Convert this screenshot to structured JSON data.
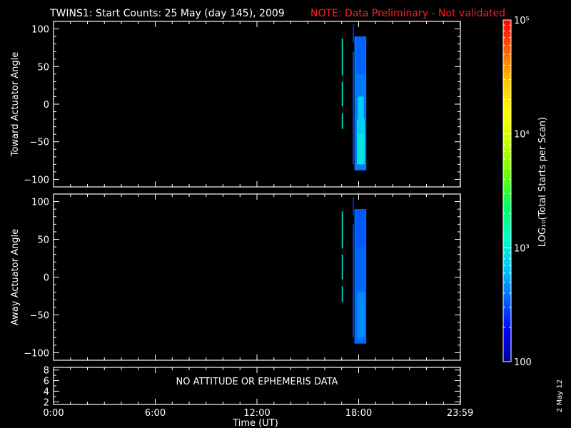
{
  "header": {
    "title": "TWINS1: Start Counts: 25 May (day 145), 2009",
    "note": "NOTE: Data Preliminary - Not validated"
  },
  "date_stamp": "2 May 12",
  "colorbar": {
    "label": "LOG₁₀(Total Starts per Scan)",
    "scale": "log",
    "range": [
      100,
      100000
    ],
    "tick_labels": [
      "100",
      "10³",
      "10⁴",
      "10⁵"
    ],
    "tick_values": [
      100,
      1000,
      10000,
      100000
    ],
    "colormap": [
      "#000096",
      "#0000ff",
      "#0064ff",
      "#00c8ff",
      "#00ffc8",
      "#00ff64",
      "#64ff00",
      "#c8ff00",
      "#ffff00",
      "#ffc800",
      "#ff6400",
      "#ff0000"
    ]
  },
  "chart_data": [
    {
      "type": "heatmap",
      "panel": "toward",
      "title": "",
      "xlabel": "",
      "ylabel": "Toward Actuator Angle",
      "xlim": [
        0,
        24
      ],
      "ylim": [
        -110,
        110
      ],
      "y_ticks": [
        100,
        50,
        0,
        -50,
        -100
      ],
      "y_tick_labels": [
        "100",
        "50",
        "0",
        "−50",
        "−100"
      ],
      "intervals": [
        {
          "t_start": 17.0,
          "t_end": 17.07,
          "angle_min": 38,
          "angle_max": 87,
          "counts": 1100
        },
        {
          "t_start": 17.0,
          "t_end": 17.07,
          "angle_min": -3,
          "angle_max": 30,
          "counts": 1050
        },
        {
          "t_start": 17.0,
          "t_end": 17.07,
          "angle_min": -33,
          "angle_max": -12,
          "counts": 1000
        },
        {
          "t_start": 17.65,
          "t_end": 17.72,
          "angle_min": 82,
          "angle_max": 106,
          "counts": 260
        },
        {
          "t_start": 17.65,
          "t_end": 17.72,
          "angle_min": -80,
          "angle_max": 70,
          "counts": 300
        },
        {
          "t_start": 17.75,
          "t_end": 18.45,
          "angle_min": -88,
          "angle_max": 90,
          "counts": 400
        },
        {
          "t_start": 17.9,
          "t_end": 18.35,
          "angle_min": -80,
          "angle_max": -20,
          "counts": 950
        },
        {
          "t_start": 17.95,
          "t_end": 18.3,
          "angle_min": -40,
          "angle_max": 10,
          "counts": 700
        },
        {
          "t_start": 17.85,
          "t_end": 18.4,
          "angle_min": 40,
          "angle_max": 90,
          "counts": 350
        }
      ]
    },
    {
      "type": "heatmap",
      "panel": "away",
      "title": "",
      "xlabel": "",
      "ylabel": "Away Actuator Angle",
      "xlim": [
        0,
        24
      ],
      "ylim": [
        -110,
        110
      ],
      "y_ticks": [
        100,
        50,
        0,
        -50,
        -100
      ],
      "y_tick_labels": [
        "100",
        "50",
        "0",
        "−50",
        "−100"
      ],
      "intervals": [
        {
          "t_start": 17.0,
          "t_end": 17.07,
          "angle_min": 38,
          "angle_max": 87,
          "counts": 1000
        },
        {
          "t_start": 17.0,
          "t_end": 17.07,
          "angle_min": -3,
          "angle_max": 30,
          "counts": 900
        },
        {
          "t_start": 17.0,
          "t_end": 17.07,
          "angle_min": -33,
          "angle_max": -12,
          "counts": 850
        },
        {
          "t_start": 17.65,
          "t_end": 17.72,
          "angle_min": 82,
          "angle_max": 106,
          "counts": 250
        },
        {
          "t_start": 17.65,
          "t_end": 17.72,
          "angle_min": -80,
          "angle_max": 70,
          "counts": 280
        },
        {
          "t_start": 17.75,
          "t_end": 18.45,
          "angle_min": -88,
          "angle_max": 90,
          "counts": 360
        },
        {
          "t_start": 17.9,
          "t_end": 18.35,
          "angle_min": -80,
          "angle_max": -20,
          "counts": 450
        },
        {
          "t_start": 17.85,
          "t_end": 18.4,
          "angle_min": 40,
          "angle_max": 90,
          "counts": 330
        }
      ]
    },
    {
      "type": "line",
      "panel": "attitude",
      "title": "",
      "xlabel": "Time (UT)",
      "ylabel": "",
      "xlim": [
        0,
        24
      ],
      "ylim": [
        1.5,
        8.5
      ],
      "y_ticks": [
        8,
        6,
        4,
        2
      ],
      "y_tick_labels": [
        "8",
        "6",
        "4",
        "2"
      ],
      "x_ticks": [
        0,
        6,
        12,
        18,
        23.983
      ],
      "x_tick_labels": [
        "0:00",
        "6:00",
        "12:00",
        "18:00",
        "23:59"
      ],
      "message": "NO ATTITUDE OR EPHEMERIS DATA",
      "series": []
    }
  ]
}
